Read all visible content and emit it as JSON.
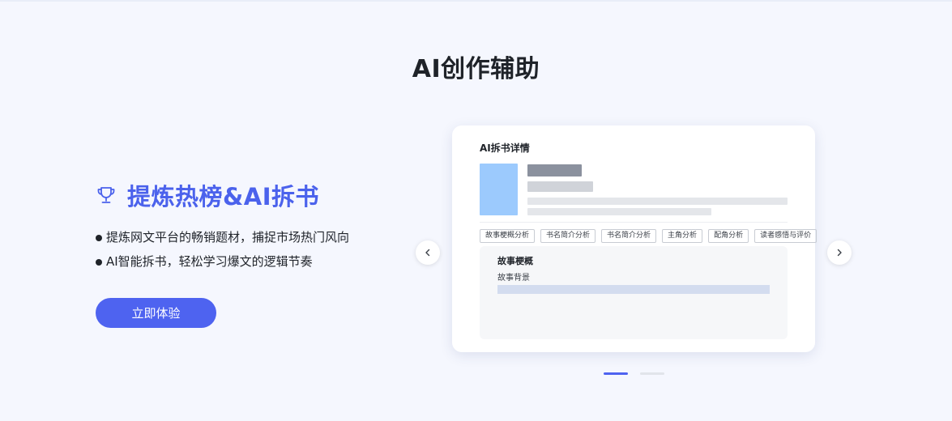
{
  "section": {
    "title": "AI创作辅助"
  },
  "feature": {
    "icon": "trophy-icon",
    "title": "提炼热榜&AI拆书",
    "bullets": [
      "提炼网文平台的畅销题材，捕捉市场热门风向",
      "AI智能拆书，轻松学习爆文的逻辑节奏"
    ],
    "cta_label": "立即体验"
  },
  "card": {
    "title": "AI拆书详情",
    "tags": [
      "故事梗概分析",
      "书名简介分析",
      "书名简介分析",
      "主角分析",
      "配角分析",
      "读者感悟与评价"
    ],
    "panel": {
      "title": "故事梗概",
      "subtitle": "故事背景"
    }
  },
  "carousel": {
    "prev_icon": "chevron-left-icon",
    "next_icon": "chevron-right-icon",
    "slide_count": 2,
    "active_index": 0
  },
  "colors": {
    "accent": "#4e63f0",
    "title_accent": "#4b62ec",
    "background": "#f5f7fe",
    "cover": "#9ccafd"
  }
}
